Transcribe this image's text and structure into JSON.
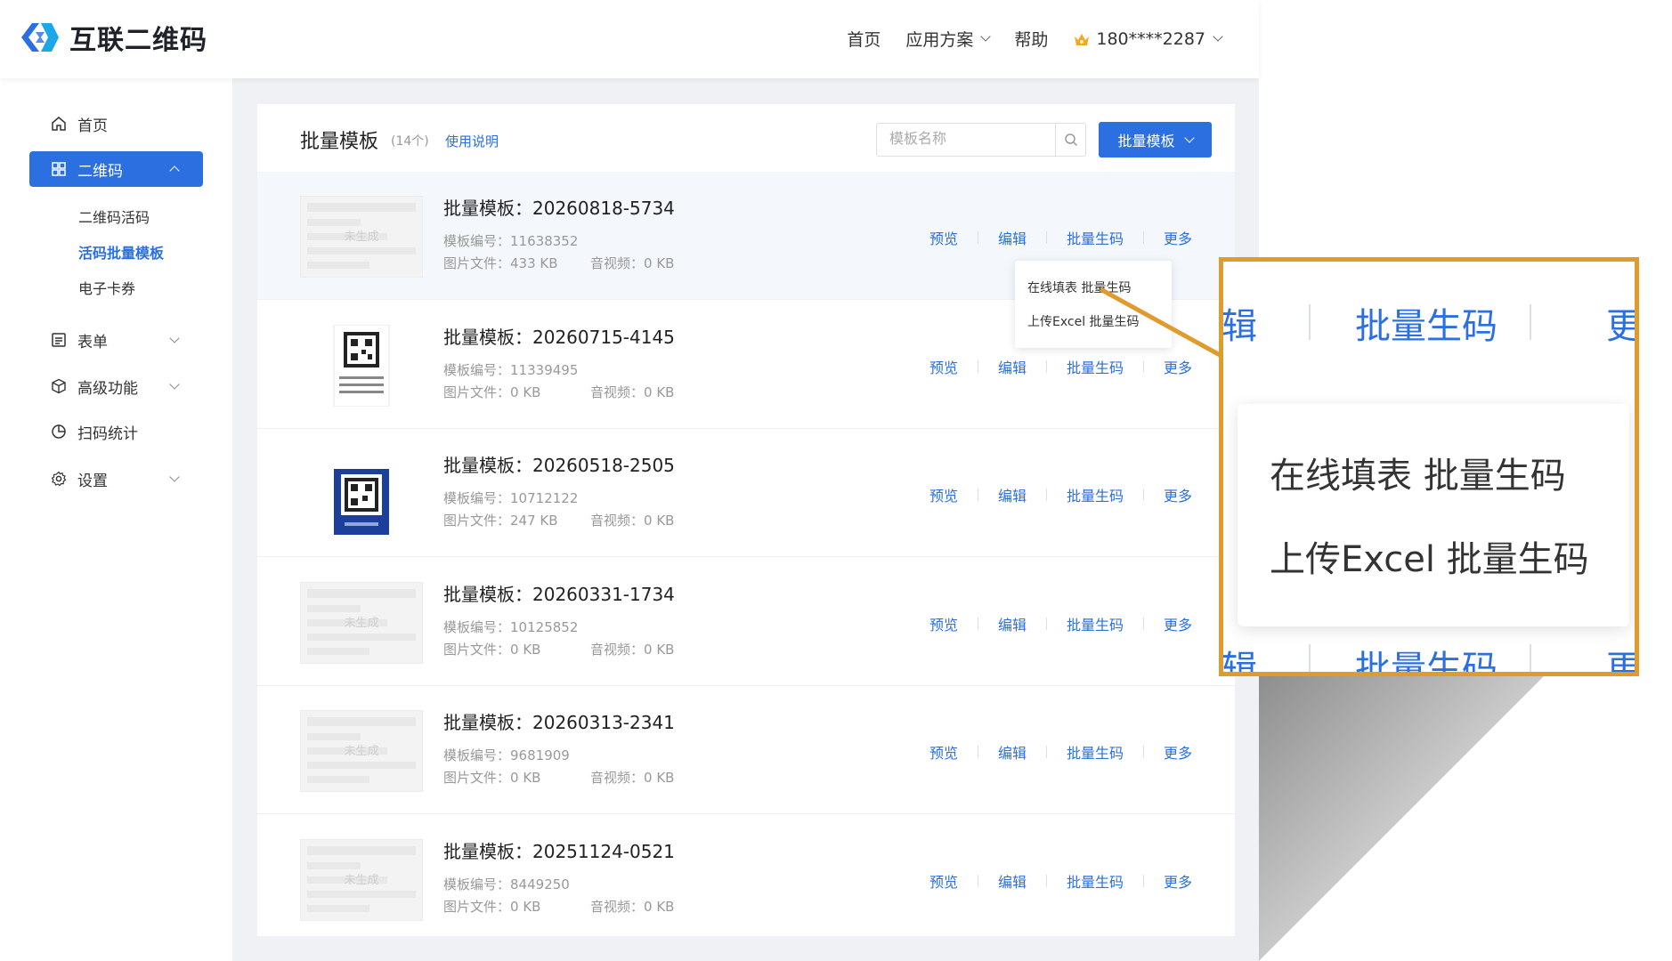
{
  "brand": {
    "name": "互联二维码"
  },
  "top_nav": {
    "home": "首页",
    "solutions": "应用方案",
    "help": "帮助",
    "account": "180****2287"
  },
  "sidebar": {
    "items": [
      {
        "label": "首页",
        "icon": "home-icon"
      },
      {
        "label": "二维码",
        "icon": "grid-icon",
        "active": true
      },
      {
        "label": "表单",
        "icon": "form-icon"
      },
      {
        "label": "高级功能",
        "icon": "cube-icon"
      },
      {
        "label": "扫码统计",
        "icon": "pie-icon"
      },
      {
        "label": "设置",
        "icon": "gear-icon"
      }
    ],
    "sub_items": [
      "二维码活码",
      "活码批量模板",
      "电子卡券"
    ]
  },
  "panel": {
    "title": "批量模板",
    "count": "(14个)",
    "help_link": "使用说明",
    "search_placeholder": "模板名称",
    "batch_button": "批量模板"
  },
  "labels": {
    "code_prefix": "模板编号：",
    "image_prefix": "图片文件：",
    "av_prefix": "音视频：",
    "not_generated": "未生成"
  },
  "actions": {
    "preview": "预览",
    "edit": "编辑",
    "batch": "批量生码",
    "more": "更多"
  },
  "templates": [
    {
      "name": "批量模板：20260818-5734",
      "code": "11638352",
      "image_size": "433 KB",
      "av_size": "0 KB",
      "thumb": "placeholder"
    },
    {
      "name": "批量模板：20260715-4145",
      "code": "11339495",
      "image_size": "0 KB",
      "av_size": "0 KB",
      "thumb": "qr-label"
    },
    {
      "name": "批量模板：20260518-2505",
      "code": "10712122",
      "image_size": "247 KB",
      "av_size": "0 KB",
      "thumb": "blue-card"
    },
    {
      "name": "批量模板：20260331-1734",
      "code": "10125852",
      "image_size": "0 KB",
      "av_size": "0 KB",
      "thumb": "placeholder"
    },
    {
      "name": "批量模板：20260313-2341",
      "code": "9681909",
      "image_size": "0 KB",
      "av_size": "0 KB",
      "thumb": "placeholder"
    },
    {
      "name": "批量模板：20251124-0521",
      "code": "8449250",
      "image_size": "0 KB",
      "av_size": "0 KB",
      "thumb": "placeholder"
    }
  ],
  "dropdown": {
    "online_fill": "在线填表 批量生码",
    "excel_upload": "上传Excel 批量生码"
  },
  "zoom": {
    "edit_fragment": "辑",
    "batch": "批量生码",
    "more_fragment": "更",
    "online_fill": "在线填表 批量生码",
    "excel_upload": "上传Excel 批量生码"
  },
  "colors": {
    "accent": "#2b6fe0",
    "callout": "#e09b2d",
    "main_bg": "#eff1f4"
  }
}
